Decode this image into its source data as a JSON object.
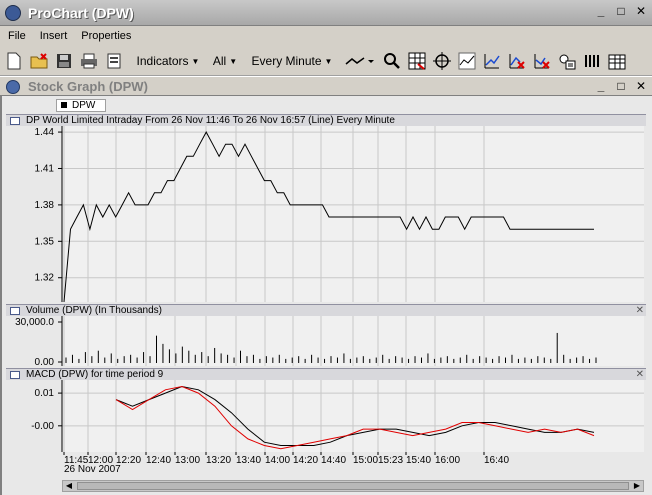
{
  "window": {
    "title": "ProChart (DPW)"
  },
  "menu": [
    "File",
    "Insert",
    "Properties"
  ],
  "toolbar": {
    "indicators": "Indicators",
    "all": "All",
    "interval": "Every Minute"
  },
  "doc": {
    "title": "Stock Graph (DPW)",
    "legend": "DPW"
  },
  "price_panel": {
    "title": "DP World Limited Intraday   From 26 Nov 11:46 To 26 Nov 16:57  (Line)  Every Minute",
    "ticks": [
      "1.44",
      "1.41",
      "1.38",
      "1.35",
      "1.32"
    ]
  },
  "volume_panel": {
    "title": "Volume (DPW) (In Thousands)",
    "ticks": [
      "30,000.0",
      "0.00"
    ]
  },
  "macd_panel": {
    "title": "MACD (DPW) for time period 9",
    "ticks": [
      "0.01",
      "-0.00"
    ]
  },
  "x_axis": {
    "ticks": [
      "11:45",
      "12:00",
      "12:20",
      "12:40",
      "13:00",
      "13:20",
      "13:40",
      "14:00",
      "14:20",
      "14:40",
      "15:00",
      "15:23",
      "15:40",
      "16:00",
      "16:40"
    ],
    "date": "26 Nov 2007"
  },
  "colors": {
    "price": "#000000",
    "macd": "#000000",
    "signal": "#e00000"
  },
  "chart_data": [
    {
      "type": "line",
      "series": [
        {
          "name": "DPW",
          "values": [
            1.3,
            1.36,
            1.37,
            1.38,
            1.36,
            1.38,
            1.37,
            1.38,
            1.37,
            1.38,
            1.39,
            1.38,
            1.38,
            1.38,
            1.39,
            1.39,
            1.4,
            1.4,
            1.41,
            1.42,
            1.42,
            1.43,
            1.44,
            1.43,
            1.42,
            1.43,
            1.43,
            1.42,
            1.43,
            1.42,
            1.41,
            1.4,
            1.4,
            1.39,
            1.39,
            1.38,
            1.38,
            1.38,
            1.38,
            1.38,
            1.38,
            1.37,
            1.37,
            1.37,
            1.37,
            1.37,
            1.37,
            1.37,
            1.37,
            1.37,
            1.37,
            1.37,
            1.37,
            1.36,
            1.37,
            1.36,
            1.37,
            1.36,
            1.36,
            1.37,
            1.37,
            1.37,
            1.36,
            1.37,
            1.37,
            1.37,
            1.37,
            1.37,
            1.37,
            1.36,
            1.36,
            1.36,
            1.36,
            1.36,
            1.36,
            1.36,
            1.36,
            1.36,
            1.36,
            1.36,
            1.36,
            1.36,
            1.36
          ]
        }
      ],
      "ylim": [
        1.3,
        1.445
      ]
    },
    {
      "type": "bar",
      "series": [
        {
          "name": "Volume",
          "values": [
            4,
            6,
            3,
            8,
            5,
            9,
            4,
            7,
            3,
            5,
            6,
            4,
            8,
            5,
            20,
            14,
            10,
            7,
            12,
            9,
            6,
            8,
            5,
            11,
            7,
            6,
            4,
            9,
            5,
            6,
            3,
            5,
            4,
            6,
            3,
            4,
            5,
            3,
            6,
            4,
            3,
            5,
            4,
            7,
            3,
            4,
            5,
            3,
            4,
            6,
            3,
            5,
            4,
            3,
            5,
            4,
            7,
            3,
            4,
            5,
            3,
            4,
            6,
            3,
            5,
            4,
            3,
            5,
            4,
            6,
            3,
            4,
            3,
            5,
            4,
            3,
            22,
            6,
            3,
            4,
            5,
            3,
            4
          ]
        }
      ],
      "ylim": [
        0,
        30000
      ]
    },
    {
      "type": "line",
      "series": [
        {
          "name": "MACD",
          "values": [
            0.008,
            0.006,
            0.008,
            0.01,
            0.012,
            0.011,
            0.008,
            0.004,
            -0.001,
            -0.005,
            -0.006,
            -0.006,
            -0.006,
            -0.005,
            -0.003,
            -0.002,
            -0.001,
            -0.001,
            -0.002,
            -0.003,
            -0.002,
            0.0,
            0.001,
            0.001,
            0.0,
            -0.001,
            -0.002,
            -0.002,
            -0.001,
            -0.002
          ]
        },
        {
          "name": "Signal",
          "values": [
            0.008,
            0.005,
            0.008,
            0.011,
            0.012,
            0.01,
            0.006,
            0.0,
            -0.004,
            -0.006,
            -0.007,
            -0.006,
            -0.005,
            -0.004,
            -0.003,
            -0.001,
            -0.001,
            -0.002,
            -0.003,
            -0.002,
            -0.001,
            0.001,
            0.001,
            0.0,
            -0.001,
            -0.002,
            -0.001,
            -0.002,
            -0.001,
            -0.003
          ]
        }
      ],
      "ylim": [
        -0.008,
        0.014
      ]
    }
  ]
}
